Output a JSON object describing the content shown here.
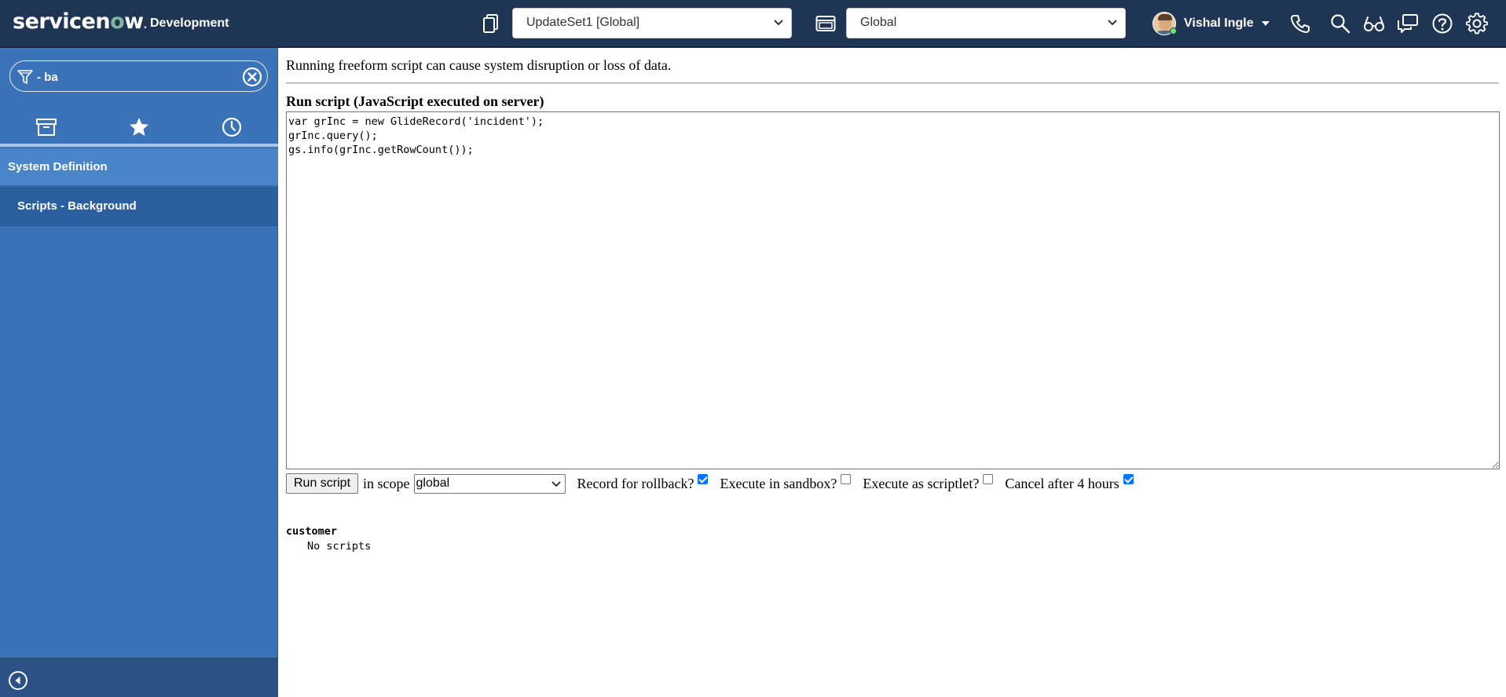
{
  "header": {
    "logo_text_part1": "servicen",
    "logo_text_o": "o",
    "logo_text_part2": "w",
    "logo_registered": ".",
    "instance_name": "Development",
    "update_set_picker": "UpdateSet1 [Global]",
    "application_picker": "Global",
    "user_name": "Vishal Ingle",
    "icons": [
      "update-set-icon",
      "application-icon",
      "phone-icon",
      "search-icon",
      "accessibility-glasses-icon",
      "connect-chat-icon",
      "help-icon",
      "settings-gear-icon"
    ]
  },
  "sidebar": {
    "filter_value": "- ba",
    "tabs": [
      "all-applications-archive-icon",
      "favorites-star-icon",
      "history-clock-icon"
    ],
    "section_label": "System Definition",
    "module_label": "Scripts - Background"
  },
  "main": {
    "warning": "Running freeform script can cause system disruption or loss of data.",
    "heading": "Run script (JavaScript executed on server)",
    "script": "var grInc = new GlideRecord('incident');\ngrInc.query();\ngs.info(grInc.getRowCount());",
    "run_button": "Run script",
    "scope_label": "in scope",
    "scope_value": "global",
    "options": [
      {
        "label": "Record for rollback?",
        "checked": true
      },
      {
        "label": "Execute in sandbox?",
        "checked": false
      },
      {
        "label": "Execute as scriptlet?",
        "checked": false
      },
      {
        "label": "Cancel after 4 hours",
        "checked": true
      }
    ],
    "output_title": "customer",
    "output_line": "No scripts"
  },
  "colors": {
    "header_bg": "#1f3554",
    "sidebar_bg": "#3b73b9",
    "module_selected_bg": "#2b5f9f",
    "logo_accent": "#81b5a1",
    "checkbox_checked": "#0075ff"
  }
}
